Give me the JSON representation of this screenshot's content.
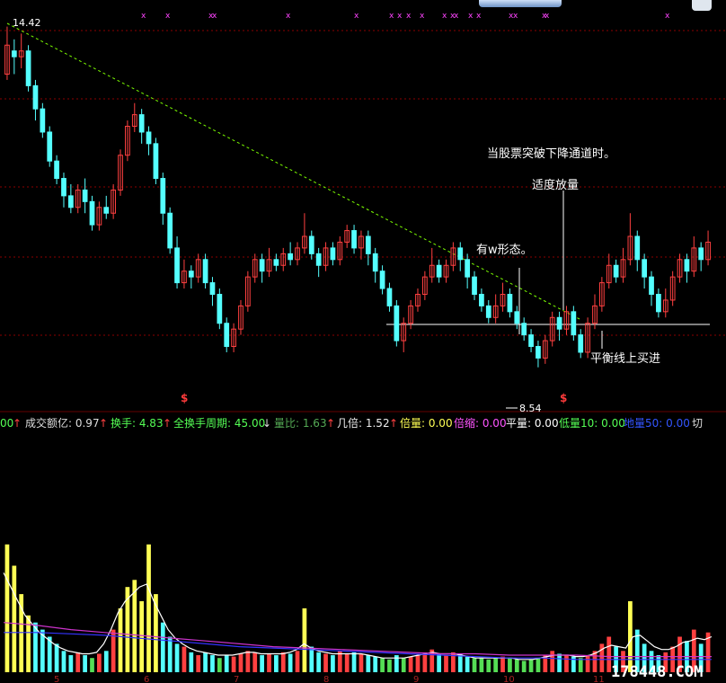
{
  "chart_data": {
    "type": "candlestick",
    "price_ylim": [
      7.9,
      14.6
    ],
    "volume_ylim": [
      0,
      1
    ],
    "high_label": "14.42",
    "low_label": "8.54",
    "candles": [
      [
        13.6,
        14.1,
        14.42,
        13.5
      ],
      [
        14.0,
        13.9,
        14.2,
        13.6
      ],
      [
        13.9,
        14.0,
        14.3,
        13.7
      ],
      [
        14.0,
        13.4,
        14.1,
        13.3
      ],
      [
        13.4,
        13.0,
        13.5,
        12.8
      ],
      [
        13.0,
        12.6,
        13.1,
        12.5
      ],
      [
        12.6,
        12.1,
        12.7,
        12.0
      ],
      [
        12.1,
        11.8,
        12.2,
        11.7
      ],
      [
        11.8,
        11.5,
        11.9,
        11.3
      ],
      [
        11.5,
        11.3,
        11.7,
        11.2
      ],
      [
        11.3,
        11.6,
        11.7,
        11.2
      ],
      [
        11.6,
        11.4,
        11.8,
        11.2
      ],
      [
        11.4,
        11.0,
        11.5,
        10.9
      ],
      [
        11.0,
        11.3,
        11.4,
        10.9
      ],
      [
        11.3,
        11.2,
        11.5,
        11.1
      ],
      [
        11.2,
        11.6,
        11.7,
        11.1
      ],
      [
        11.6,
        12.2,
        12.3,
        11.5
      ],
      [
        12.2,
        12.7,
        12.8,
        12.1
      ],
      [
        12.7,
        12.9,
        13.1,
        12.6
      ],
      [
        12.9,
        12.6,
        13.0,
        12.4
      ],
      [
        12.6,
        12.4,
        12.7,
        12.2
      ],
      [
        12.4,
        11.8,
        12.5,
        11.7
      ],
      [
        11.8,
        11.2,
        11.9,
        11.0
      ],
      [
        11.2,
        10.6,
        11.3,
        10.5
      ],
      [
        10.6,
        10.0,
        10.8,
        9.9
      ],
      [
        10.0,
        10.2,
        10.4,
        9.9
      ],
      [
        10.2,
        10.1,
        10.3,
        9.9
      ],
      [
        10.1,
        10.4,
        10.5,
        10.0
      ],
      [
        10.4,
        10.0,
        10.5,
        9.9
      ],
      [
        10.0,
        9.8,
        10.1,
        9.6
      ],
      [
        9.8,
        9.3,
        9.9,
        9.2
      ],
      [
        9.3,
        8.9,
        9.4,
        8.8
      ],
      [
        8.9,
        9.2,
        9.3,
        8.8
      ],
      [
        9.2,
        9.6,
        9.7,
        9.1
      ],
      [
        9.6,
        10.1,
        10.2,
        9.5
      ],
      [
        10.1,
        10.4,
        10.5,
        10.0
      ],
      [
        10.4,
        10.2,
        10.5,
        10.0
      ],
      [
        10.2,
        10.4,
        10.6,
        10.1
      ],
      [
        10.4,
        10.3,
        10.5,
        10.2
      ],
      [
        10.3,
        10.5,
        10.6,
        10.2
      ],
      [
        10.5,
        10.4,
        10.7,
        10.3
      ],
      [
        10.4,
        10.6,
        10.7,
        10.3
      ],
      [
        10.6,
        10.8,
        11.2,
        10.5
      ],
      [
        10.8,
        10.5,
        10.9,
        10.4
      ],
      [
        10.5,
        10.3,
        10.6,
        10.1
      ],
      [
        10.3,
        10.6,
        10.7,
        10.2
      ],
      [
        10.6,
        10.4,
        10.7,
        10.3
      ],
      [
        10.4,
        10.7,
        10.8,
        10.3
      ],
      [
        10.7,
        10.9,
        11.0,
        10.6
      ],
      [
        10.9,
        10.6,
        11.0,
        10.5
      ],
      [
        10.6,
        10.8,
        10.9,
        10.4
      ],
      [
        10.8,
        10.5,
        10.9,
        10.3
      ],
      [
        10.5,
        10.2,
        10.6,
        10.0
      ],
      [
        10.2,
        9.9,
        10.3,
        9.8
      ],
      [
        9.9,
        9.6,
        10.0,
        9.5
      ],
      [
        9.6,
        9.0,
        9.7,
        8.9
      ],
      [
        9.0,
        9.3,
        9.4,
        8.8
      ],
      [
        9.3,
        9.6,
        9.7,
        9.2
      ],
      [
        9.6,
        9.8,
        9.9,
        9.5
      ],
      [
        9.8,
        10.1,
        10.2,
        9.7
      ],
      [
        10.1,
        10.3,
        10.6,
        10.0
      ],
      [
        10.3,
        10.1,
        10.4,
        10.0
      ],
      [
        10.1,
        10.3,
        10.4,
        10.0
      ],
      [
        10.3,
        10.6,
        10.7,
        10.2
      ],
      [
        10.6,
        10.4,
        10.7,
        10.2
      ],
      [
        10.4,
        10.1,
        10.5,
        9.9
      ],
      [
        10.1,
        9.8,
        10.2,
        9.7
      ],
      [
        9.8,
        9.6,
        9.9,
        9.5
      ],
      [
        9.6,
        9.4,
        9.7,
        9.3
      ],
      [
        9.4,
        9.6,
        9.8,
        9.3
      ],
      [
        9.6,
        9.8,
        10.0,
        9.5
      ],
      [
        9.8,
        9.5,
        9.9,
        9.4
      ],
      [
        9.5,
        9.3,
        9.6,
        9.2
      ],
      [
        9.3,
        9.1,
        9.4,
        9.0
      ],
      [
        9.1,
        8.9,
        9.2,
        8.8
      ],
      [
        8.9,
        8.7,
        9.0,
        8.54
      ],
      [
        8.7,
        9.0,
        9.1,
        8.6
      ],
      [
        9.0,
        9.4,
        9.5,
        8.9
      ],
      [
        9.4,
        9.2,
        9.5,
        9.0
      ],
      [
        9.2,
        9.5,
        9.6,
        9.1
      ],
      [
        9.5,
        9.1,
        9.6,
        9.0
      ],
      [
        9.1,
        8.8,
        9.2,
        8.7
      ],
      [
        8.8,
        9.3,
        9.4,
        8.7
      ],
      [
        9.3,
        9.6,
        9.8,
        9.2
      ],
      [
        9.6,
        10.0,
        10.1,
        9.5
      ],
      [
        10.0,
        10.3,
        10.5,
        9.9
      ],
      [
        10.3,
        10.1,
        10.4,
        10.0
      ],
      [
        10.1,
        10.4,
        10.6,
        10.0
      ],
      [
        10.4,
        10.8,
        11.2,
        10.3
      ],
      [
        10.8,
        10.4,
        10.9,
        10.2
      ],
      [
        10.4,
        10.1,
        10.5,
        9.9
      ],
      [
        10.1,
        9.8,
        10.2,
        9.6
      ],
      [
        9.8,
        9.5,
        9.9,
        9.4
      ],
      [
        9.5,
        9.7,
        9.9,
        9.4
      ],
      [
        9.7,
        10.1,
        10.2,
        9.6
      ],
      [
        10.1,
        10.4,
        10.5,
        10.0
      ],
      [
        10.4,
        10.2,
        10.5,
        10.0
      ],
      [
        10.2,
        10.6,
        10.8,
        10.1
      ],
      [
        10.6,
        10.4,
        10.7,
        10.2
      ],
      [
        10.4,
        10.7,
        10.9,
        10.3
      ]
    ],
    "volumes": [
      0.9,
      0.75,
      0.55,
      0.4,
      0.35,
      0.3,
      0.25,
      0.2,
      0.15,
      0.12,
      0.14,
      0.12,
      0.1,
      0.13,
      0.15,
      0.3,
      0.45,
      0.6,
      0.65,
      0.5,
      0.9,
      0.55,
      0.35,
      0.25,
      0.2,
      0.18,
      0.14,
      0.12,
      0.14,
      0.12,
      0.1,
      0.12,
      0.11,
      0.13,
      0.15,
      0.14,
      0.12,
      0.13,
      0.12,
      0.14,
      0.13,
      0.15,
      0.45,
      0.18,
      0.14,
      0.13,
      0.12,
      0.15,
      0.13,
      0.14,
      0.13,
      0.12,
      0.11,
      0.1,
      0.09,
      0.12,
      0.1,
      0.11,
      0.12,
      0.14,
      0.16,
      0.13,
      0.12,
      0.14,
      0.13,
      0.11,
      0.1,
      0.1,
      0.09,
      0.1,
      0.11,
      0.1,
      0.09,
      0.08,
      0.09,
      0.1,
      0.12,
      0.15,
      0.13,
      0.12,
      0.11,
      0.1,
      0.12,
      0.15,
      0.2,
      0.25,
      0.18,
      0.15,
      0.5,
      0.3,
      0.2,
      0.15,
      0.12,
      0.14,
      0.18,
      0.25,
      0.22,
      0.3,
      0.2,
      0.28
    ],
    "volume_ma": [
      0.7,
      0.6,
      0.5,
      0.4,
      0.34,
      0.28,
      0.24,
      0.2,
      0.17,
      0.15,
      0.14,
      0.13,
      0.13,
      0.14,
      0.2,
      0.3,
      0.42,
      0.5,
      0.55,
      0.6,
      0.62,
      0.5,
      0.4,
      0.3,
      0.24,
      0.2,
      0.17,
      0.15,
      0.14,
      0.13,
      0.12,
      0.12,
      0.12,
      0.13,
      0.14,
      0.14,
      0.13,
      0.13,
      0.13,
      0.13,
      0.14,
      0.16,
      0.2,
      0.17,
      0.15,
      0.14,
      0.13,
      0.13,
      0.13,
      0.13,
      0.13,
      0.12,
      0.11,
      0.1,
      0.1,
      0.1,
      0.1,
      0.11,
      0.12,
      0.13,
      0.14,
      0.13,
      0.13,
      0.13,
      0.12,
      0.11,
      0.1,
      0.1,
      0.1,
      0.1,
      0.1,
      0.1,
      0.09,
      0.09,
      0.09,
      0.1,
      0.11,
      0.12,
      0.12,
      0.12,
      0.11,
      0.11,
      0.12,
      0.14,
      0.17,
      0.19,
      0.18,
      0.17,
      0.25,
      0.26,
      0.22,
      0.18,
      0.16,
      0.16,
      0.18,
      0.21,
      0.22,
      0.24,
      0.23,
      0.25
    ],
    "volume_ma_long": [
      0.35,
      0.33,
      0.3,
      0.28,
      0.26,
      0.24,
      0.22,
      0.2,
      0.18,
      0.17,
      0.16,
      0.15,
      0.14,
      0.13,
      0.13,
      0.12,
      0.12,
      0.12,
      0.11,
      0.11,
      0.11,
      0.11
    ],
    "volume_ma_long2": [
      0.28,
      0.28,
      0.27,
      0.26,
      0.24,
      0.22,
      0.2,
      0.18,
      0.17,
      0.16,
      0.15,
      0.14,
      0.13,
      0.12,
      0.11,
      0.1,
      0.1,
      0.09,
      0.09,
      0.09,
      0.09,
      0.09
    ],
    "x_tick_labels": [
      "5",
      "6",
      "7",
      "8",
      "9",
      "10",
      "11"
    ]
  },
  "indicator_bar": {
    "item0": "00",
    "item1": "成交额亿: 0.97",
    "item2": "换手: 4.83",
    "item3": "全换手周期: 45.00",
    "item4": "量比: 1.63",
    "item5": "几倍: 1.52",
    "item6": "倍量: 0.00",
    "item7": "倍缩: 0.00",
    "item8": "平量: 0.00",
    "item9": "低量10: 0.00",
    "item10": "地量50: 0.00",
    "item11": "切"
  },
  "annotations": {
    "breakout": "当股票突破下降通道时。",
    "volume": "适度放量",
    "w_shape": "有w形态。",
    "buy": "平衡线上买进"
  },
  "markers": {
    "s1": "$",
    "s2": "$"
  },
  "watermark": "178448.COM",
  "colors": {
    "up": "#ff4040",
    "down": "#54ffff",
    "grid": "#8b0000",
    "trend": "#7cfc00",
    "vol_yellow": "#ffff55",
    "vol_green": "#55dd55",
    "vol_magenta": "#ff55ff",
    "ma_white": "#ffffff",
    "ma_blue": "#3333ff",
    "ma_pink": "#cc33cc",
    "event_x": "#ff44ff"
  }
}
